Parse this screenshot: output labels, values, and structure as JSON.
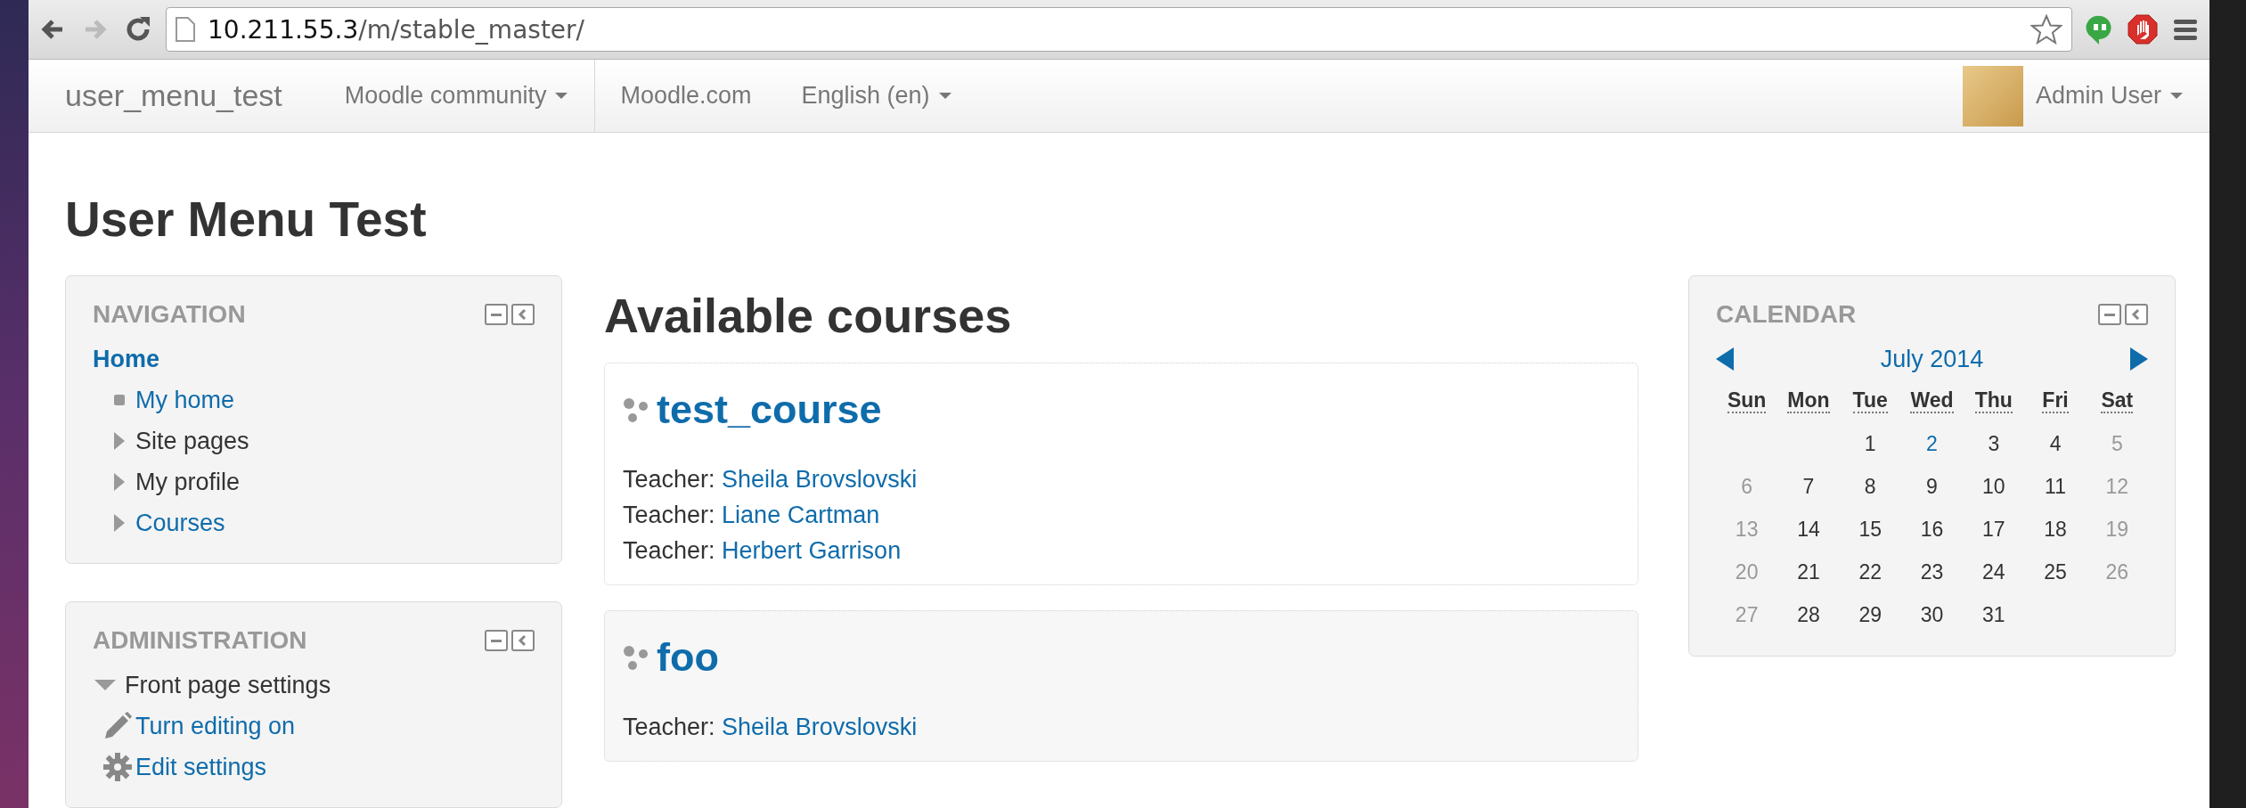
{
  "browser": {
    "url_host": "10.211.55.3",
    "url_path": "/m/stable_master/",
    "back_disabled": false,
    "forward_disabled": true
  },
  "navbar": {
    "brand": "user_menu_test",
    "menus": [
      {
        "label": "Moodle community",
        "dropdown": true,
        "divider_after": true
      },
      {
        "label": "Moodle.com",
        "dropdown": false,
        "divider_after": false
      },
      {
        "label": "English (en)",
        "dropdown": true,
        "divider_after": false
      }
    ],
    "user": {
      "name": "Admin User",
      "dropdown": true
    }
  },
  "page_title": "User Menu Test",
  "blocks_left": [
    {
      "title": "NAVIGATION",
      "items": [
        {
          "label": "Home",
          "kind": "root",
          "link": true,
          "children": [
            {
              "label": "My home",
              "kind": "bullet",
              "link": true
            },
            {
              "label": "Site pages",
              "kind": "branch",
              "link": false,
              "expanded": false
            },
            {
              "label": "My profile",
              "kind": "branch",
              "link": false,
              "expanded": false
            },
            {
              "label": "Courses",
              "kind": "branch",
              "link": true,
              "expanded": false
            }
          ]
        }
      ]
    },
    {
      "title": "ADMINISTRATION",
      "items": [
        {
          "label": "Front page settings",
          "kind": "branch",
          "link": false,
          "expanded": true,
          "children": [
            {
              "label": "Turn editing on",
              "kind": "pencil",
              "link": true
            },
            {
              "label": "Edit settings",
              "kind": "gear",
              "link": true
            }
          ]
        }
      ]
    }
  ],
  "main": {
    "heading": "Available courses",
    "courses": [
      {
        "name": "test_course",
        "teachers": [
          {
            "role": "Teacher:",
            "name": "Sheila Brovslovski"
          },
          {
            "role": "Teacher:",
            "name": "Liane Cartman"
          },
          {
            "role": "Teacher:",
            "name": "Herbert Garrison"
          }
        ]
      },
      {
        "name": "foo",
        "teachers": [
          {
            "role": "Teacher:",
            "name": "Sheila Brovslovski"
          }
        ]
      }
    ]
  },
  "calendar": {
    "title": "CALENDAR",
    "month": "July 2014",
    "weekdays": [
      "Sun",
      "Mon",
      "Tue",
      "Wed",
      "Thu",
      "Fri",
      "Sat"
    ],
    "weeks": [
      [
        {
          "kind": "blank"
        },
        {
          "kind": "blank"
        },
        {
          "day": "1",
          "kind": "weekday"
        },
        {
          "day": "2",
          "kind": "event"
        },
        {
          "day": "3",
          "kind": "weekday"
        },
        {
          "day": "4",
          "kind": "weekday"
        },
        {
          "day": "5",
          "kind": "weekend"
        }
      ],
      [
        {
          "day": "6",
          "kind": "weekend"
        },
        {
          "day": "7",
          "kind": "weekday"
        },
        {
          "day": "8",
          "kind": "weekday"
        },
        {
          "day": "9",
          "kind": "weekday"
        },
        {
          "day": "10",
          "kind": "weekday"
        },
        {
          "day": "11",
          "kind": "weekday"
        },
        {
          "day": "12",
          "kind": "weekend"
        }
      ],
      [
        {
          "day": "13",
          "kind": "weekend"
        },
        {
          "day": "14",
          "kind": "weekday"
        },
        {
          "day": "15",
          "kind": "weekday"
        },
        {
          "day": "16",
          "kind": "weekday"
        },
        {
          "day": "17",
          "kind": "weekday"
        },
        {
          "day": "18",
          "kind": "weekday"
        },
        {
          "day": "19",
          "kind": "weekend"
        }
      ],
      [
        {
          "day": "20",
          "kind": "weekend"
        },
        {
          "day": "21",
          "kind": "weekday"
        },
        {
          "day": "22",
          "kind": "weekday"
        },
        {
          "day": "23",
          "kind": "weekday"
        },
        {
          "day": "24",
          "kind": "weekday"
        },
        {
          "day": "25",
          "kind": "weekday"
        },
        {
          "day": "26",
          "kind": "weekend"
        }
      ],
      [
        {
          "day": "27",
          "kind": "weekend"
        },
        {
          "day": "28",
          "kind": "weekday"
        },
        {
          "day": "29",
          "kind": "weekday"
        },
        {
          "day": "30",
          "kind": "weekday"
        },
        {
          "day": "31",
          "kind": "weekday"
        },
        {
          "kind": "blank"
        },
        {
          "kind": "blank"
        }
      ]
    ]
  }
}
